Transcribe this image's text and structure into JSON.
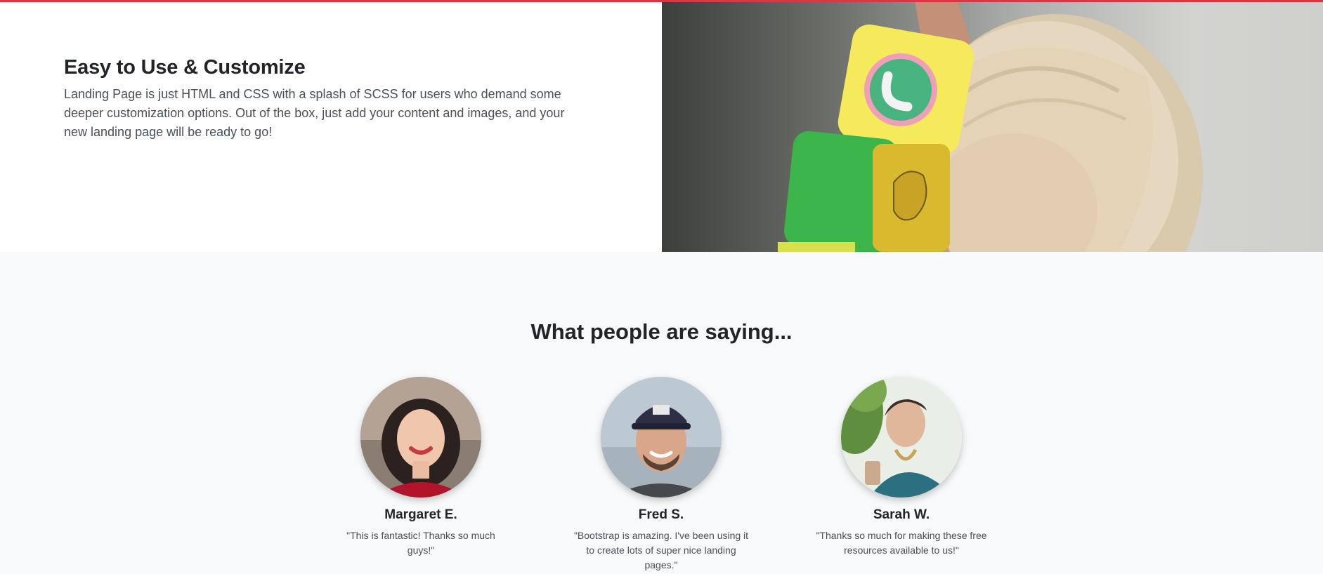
{
  "colors": {
    "accent": "#dc3545",
    "section_bg": "#f8f9fa"
  },
  "showcase": {
    "title": "Easy to Use & Customize",
    "body": "Landing Page is just HTML and CSS with a splash of SCSS for users who demand some deeper customization options. Out of the box, just add your content and images, and your new landing page will be ready to go!"
  },
  "testimonials": {
    "heading": "What people are saying...",
    "items": [
      {
        "name": "Margaret E.",
        "quote": "\"This is fantastic! Thanks so much guys!\""
      },
      {
        "name": "Fred S.",
        "quote": "\"Bootstrap is amazing. I've been using it to create lots of super nice landing pages.\""
      },
      {
        "name": "Sarah W.",
        "quote": "\"Thanks so much for making these free resources available to us!\""
      }
    ]
  }
}
